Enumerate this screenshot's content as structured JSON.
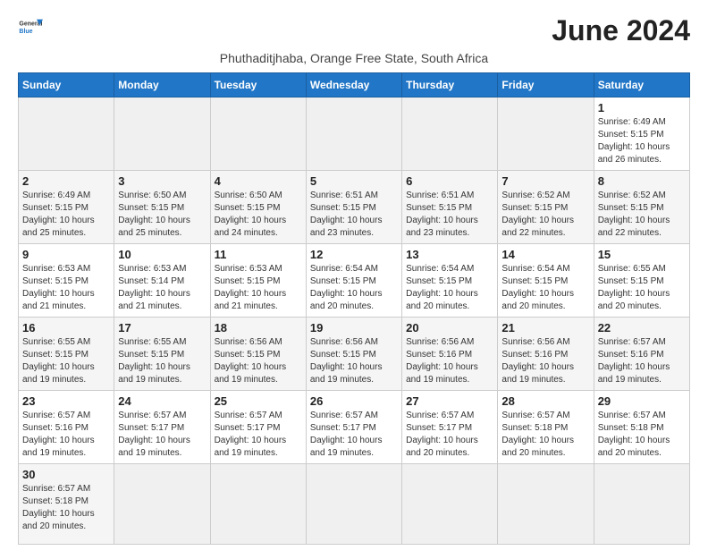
{
  "header": {
    "title": "June 2024",
    "subtitle": "Phuthaditjhaba, Orange Free State, South Africa",
    "logo_general": "General",
    "logo_blue": "Blue"
  },
  "weekdays": [
    "Sunday",
    "Monday",
    "Tuesday",
    "Wednesday",
    "Thursday",
    "Friday",
    "Saturday"
  ],
  "weeks": [
    [
      {
        "day": "",
        "info": ""
      },
      {
        "day": "",
        "info": ""
      },
      {
        "day": "",
        "info": ""
      },
      {
        "day": "",
        "info": ""
      },
      {
        "day": "",
        "info": ""
      },
      {
        "day": "",
        "info": ""
      },
      {
        "day": "1",
        "info": "Sunrise: 6:49 AM\nSunset: 5:15 PM\nDaylight: 10 hours\nand 26 minutes."
      }
    ],
    [
      {
        "day": "2",
        "info": "Sunrise: 6:49 AM\nSunset: 5:15 PM\nDaylight: 10 hours\nand 25 minutes."
      },
      {
        "day": "3",
        "info": "Sunrise: 6:50 AM\nSunset: 5:15 PM\nDaylight: 10 hours\nand 25 minutes."
      },
      {
        "day": "4",
        "info": "Sunrise: 6:50 AM\nSunset: 5:15 PM\nDaylight: 10 hours\nand 24 minutes."
      },
      {
        "day": "5",
        "info": "Sunrise: 6:51 AM\nSunset: 5:15 PM\nDaylight: 10 hours\nand 23 minutes."
      },
      {
        "day": "6",
        "info": "Sunrise: 6:51 AM\nSunset: 5:15 PM\nDaylight: 10 hours\nand 23 minutes."
      },
      {
        "day": "7",
        "info": "Sunrise: 6:52 AM\nSunset: 5:15 PM\nDaylight: 10 hours\nand 22 minutes."
      },
      {
        "day": "8",
        "info": "Sunrise: 6:52 AM\nSunset: 5:15 PM\nDaylight: 10 hours\nand 22 minutes."
      }
    ],
    [
      {
        "day": "9",
        "info": "Sunrise: 6:53 AM\nSunset: 5:15 PM\nDaylight: 10 hours\nand 21 minutes."
      },
      {
        "day": "10",
        "info": "Sunrise: 6:53 AM\nSunset: 5:14 PM\nDaylight: 10 hours\nand 21 minutes."
      },
      {
        "day": "11",
        "info": "Sunrise: 6:53 AM\nSunset: 5:15 PM\nDaylight: 10 hours\nand 21 minutes."
      },
      {
        "day": "12",
        "info": "Sunrise: 6:54 AM\nSunset: 5:15 PM\nDaylight: 10 hours\nand 20 minutes."
      },
      {
        "day": "13",
        "info": "Sunrise: 6:54 AM\nSunset: 5:15 PM\nDaylight: 10 hours\nand 20 minutes."
      },
      {
        "day": "14",
        "info": "Sunrise: 6:54 AM\nSunset: 5:15 PM\nDaylight: 10 hours\nand 20 minutes."
      },
      {
        "day": "15",
        "info": "Sunrise: 6:55 AM\nSunset: 5:15 PM\nDaylight: 10 hours\nand 20 minutes."
      }
    ],
    [
      {
        "day": "16",
        "info": "Sunrise: 6:55 AM\nSunset: 5:15 PM\nDaylight: 10 hours\nand 19 minutes."
      },
      {
        "day": "17",
        "info": "Sunrise: 6:55 AM\nSunset: 5:15 PM\nDaylight: 10 hours\nand 19 minutes."
      },
      {
        "day": "18",
        "info": "Sunrise: 6:56 AM\nSunset: 5:15 PM\nDaylight: 10 hours\nand 19 minutes."
      },
      {
        "day": "19",
        "info": "Sunrise: 6:56 AM\nSunset: 5:15 PM\nDaylight: 10 hours\nand 19 minutes."
      },
      {
        "day": "20",
        "info": "Sunrise: 6:56 AM\nSunset: 5:16 PM\nDaylight: 10 hours\nand 19 minutes."
      },
      {
        "day": "21",
        "info": "Sunrise: 6:56 AM\nSunset: 5:16 PM\nDaylight: 10 hours\nand 19 minutes."
      },
      {
        "day": "22",
        "info": "Sunrise: 6:57 AM\nSunset: 5:16 PM\nDaylight: 10 hours\nand 19 minutes."
      }
    ],
    [
      {
        "day": "23",
        "info": "Sunrise: 6:57 AM\nSunset: 5:16 PM\nDaylight: 10 hours\nand 19 minutes."
      },
      {
        "day": "24",
        "info": "Sunrise: 6:57 AM\nSunset: 5:17 PM\nDaylight: 10 hours\nand 19 minutes."
      },
      {
        "day": "25",
        "info": "Sunrise: 6:57 AM\nSunset: 5:17 PM\nDaylight: 10 hours\nand 19 minutes."
      },
      {
        "day": "26",
        "info": "Sunrise: 6:57 AM\nSunset: 5:17 PM\nDaylight: 10 hours\nand 19 minutes."
      },
      {
        "day": "27",
        "info": "Sunrise: 6:57 AM\nSunset: 5:17 PM\nDaylight: 10 hours\nand 20 minutes."
      },
      {
        "day": "28",
        "info": "Sunrise: 6:57 AM\nSunset: 5:18 PM\nDaylight: 10 hours\nand 20 minutes."
      },
      {
        "day": "29",
        "info": "Sunrise: 6:57 AM\nSunset: 5:18 PM\nDaylight: 10 hours\nand 20 minutes."
      }
    ],
    [
      {
        "day": "30",
        "info": "Sunrise: 6:57 AM\nSunset: 5:18 PM\nDaylight: 10 hours\nand 20 minutes."
      },
      {
        "day": "",
        "info": ""
      },
      {
        "day": "",
        "info": ""
      },
      {
        "day": "",
        "info": ""
      },
      {
        "day": "",
        "info": ""
      },
      {
        "day": "",
        "info": ""
      },
      {
        "day": "",
        "info": ""
      }
    ]
  ]
}
